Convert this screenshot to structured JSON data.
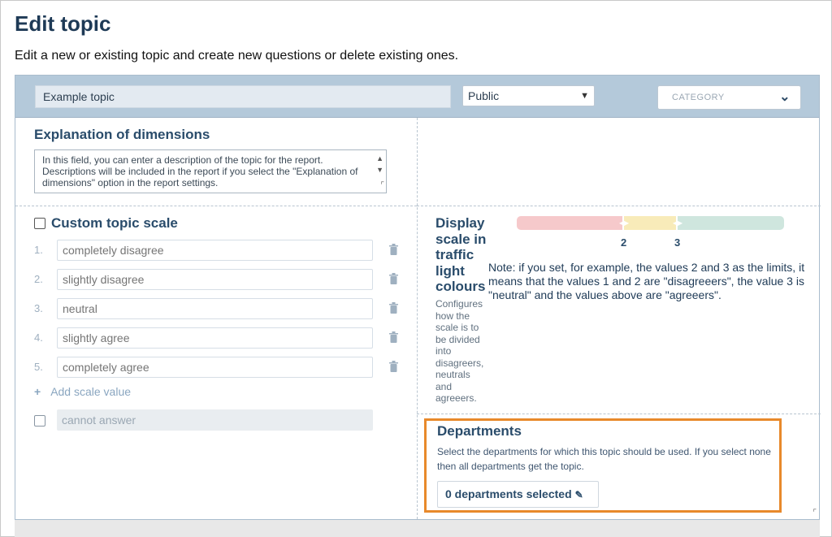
{
  "page": {
    "title": "Edit topic",
    "subtitle": "Edit a new or existing topic and create new questions or delete existing ones."
  },
  "header": {
    "topic_name": "Example topic",
    "visibility": "Public",
    "category_placeholder": "CATEGORY"
  },
  "explanation": {
    "title": "Explanation of dimensions",
    "text": "In this field, you can enter a description of the topic for the report. Descriptions will be included in the report if you select the \"Explanation of dimensions\" option in the report settings."
  },
  "scale": {
    "title": "Custom topic scale",
    "checked": false,
    "items": [
      {
        "num": "1.",
        "placeholder": "completely disagree"
      },
      {
        "num": "2.",
        "placeholder": "slightly disagree"
      },
      {
        "num": "3.",
        "placeholder": "neutral"
      },
      {
        "num": "4.",
        "placeholder": "slightly agree"
      },
      {
        "num": "5.",
        "placeholder": "completely agree"
      }
    ],
    "add_label": "Add scale value",
    "cannot_answer": "cannot answer"
  },
  "traffic": {
    "title": "Display scale in traffic light colours",
    "description": "Configures how the scale is to be divided into disagreers, neutrals and agreeers.",
    "limit_low": "2",
    "limit_high": "3",
    "note": "Note: if you set, for example, the values 2 and 3 as the limits, it means that the values 1 and 2 are \"disagreeers\", the value 3 is \"neutral\" and the values above are \"agreeers\".",
    "colors": {
      "disagree": "#f6c9cb",
      "neutral": "#f8ebb9",
      "agree": "#cfe6de"
    }
  },
  "departments": {
    "title": "Departments",
    "description": "Select the departments for which this topic should be used. If you select none then all departments get the topic.",
    "button": "0 departments selected",
    "highlight_color": "#e8892b"
  }
}
